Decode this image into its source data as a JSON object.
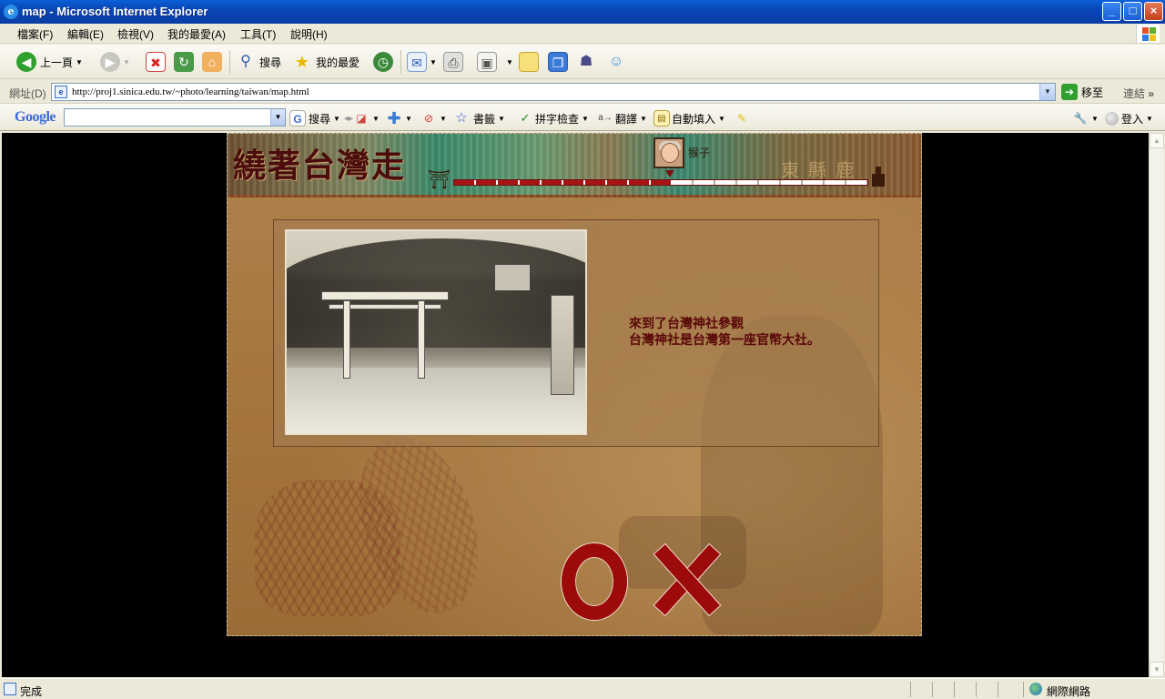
{
  "window": {
    "title": "map - Microsoft Internet Explorer",
    "controls": {
      "minimize": "_",
      "maximize": "□",
      "close": "×"
    }
  },
  "menu": [
    {
      "label": "檔案(F)"
    },
    {
      "label": "編輯(E)"
    },
    {
      "label": "檢視(V)"
    },
    {
      "label": "我的最愛(A)"
    },
    {
      "label": "工具(T)"
    },
    {
      "label": "說明(H)"
    }
  ],
  "toolbar": {
    "back_label": "上一頁",
    "search_label": "搜尋",
    "favorites_label": "我的最愛"
  },
  "address": {
    "label": "網址(D)",
    "url": "http://proj1.sinica.edu.tw/~photo/learning/taiwan/map.html",
    "go_label": "移至",
    "links_label": "連結"
  },
  "google_bar": {
    "logo": "Google",
    "search_value": "",
    "search_label": "搜尋",
    "bookmarks_label": "書籤",
    "spellcheck_label": "拼字檢查",
    "translate_label": "翻譯",
    "autofill_label": "自動填入",
    "signin_label": "登入"
  },
  "game": {
    "brand_title": "繞著台灣走",
    "banner_faded_text": "東縣鹿",
    "avatar_name": "猴子",
    "progress": {
      "filled_segments": 10,
      "total_segments": 19
    },
    "message_line1": "來到了台灣神社參觀",
    "message_line2": "台灣神社是台灣第一座官幣大社。",
    "answer_true": "O",
    "answer_false": "X",
    "accent_color": "#9c0a0a"
  },
  "status": {
    "text": "完成",
    "zone": "網際網路"
  }
}
